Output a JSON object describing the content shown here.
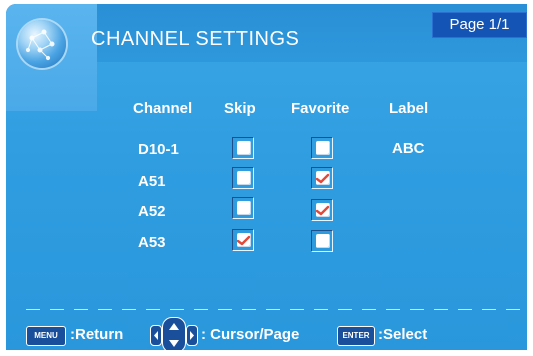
{
  "header": {
    "title": "CHANNEL SETTINGS",
    "page_indicator": "Page 1/1",
    "logo_icon": "globe-icon"
  },
  "table": {
    "columns": [
      "Channel",
      "Skip",
      "Favorite",
      "Label"
    ],
    "rows": [
      {
        "channel": "D10-1",
        "skip": false,
        "favorite": false,
        "label": "ABC"
      },
      {
        "channel": "A51",
        "skip": false,
        "favorite": true,
        "label": ""
      },
      {
        "channel": "A52",
        "skip": false,
        "favorite": true,
        "label": ""
      },
      {
        "channel": "A53",
        "skip": true,
        "favorite": false,
        "label": ""
      }
    ]
  },
  "footer": {
    "menu_key": "MENU",
    "return_label": ":Return",
    "cursor_label": ": Cursor/Page",
    "enter_key": "ENTER",
    "select_label": ":Select"
  },
  "colors": {
    "background": "#2f9de0",
    "badge": "#1454b5",
    "checkmark": "#e2493a"
  }
}
